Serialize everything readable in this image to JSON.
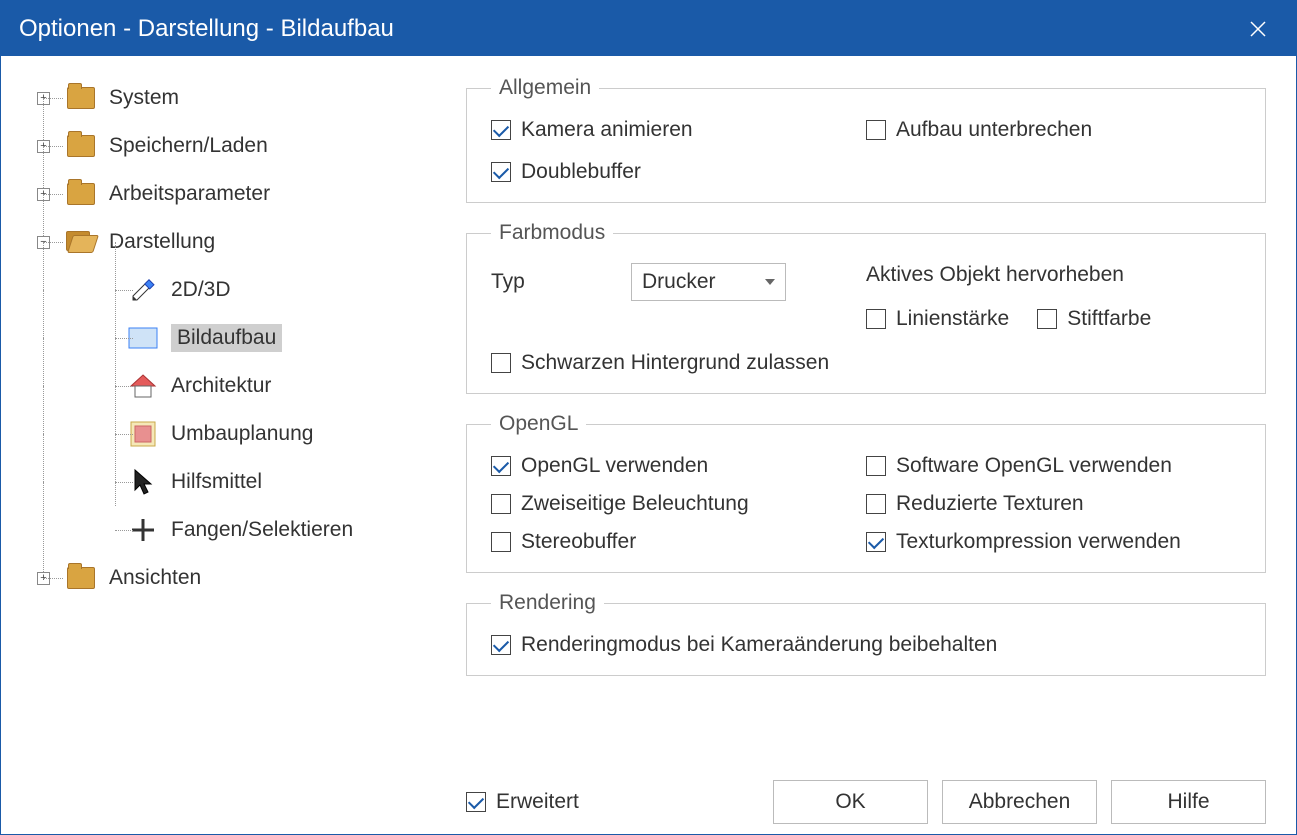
{
  "window": {
    "title": "Optionen - Darstellung - Bildaufbau"
  },
  "tree": {
    "system": "System",
    "speichern": "Speichern/Laden",
    "arbeit": "Arbeitsparameter",
    "darstellung": "Darstellung",
    "d_2d3d": "2D/3D",
    "d_bild": "Bildaufbau",
    "d_arch": "Architektur",
    "d_umbau": "Umbauplanung",
    "d_hilf": "Hilfsmittel",
    "d_fangen": "Fangen/Selektieren",
    "ansichten": "Ansichten"
  },
  "groups": {
    "allgemein": {
      "legend": "Allgemein",
      "kamera": "Kamera animieren",
      "doublebuffer": "Doublebuffer",
      "aufbau": "Aufbau unterbrechen"
    },
    "farbmodus": {
      "legend": "Farbmodus",
      "typ_label": "Typ",
      "typ_value": "Drucker",
      "aktives": "Aktives Objekt hervorheben",
      "linien": "Linienstärke",
      "stift": "Stiftfarbe",
      "schwarz": "Schwarzen Hintergrund zulassen"
    },
    "opengl": {
      "legend": "OpenGL",
      "use": "OpenGL verwenden",
      "zwei": "Zweiseitige Beleuchtung",
      "stereo": "Stereobuffer",
      "software": "Software OpenGL verwenden",
      "reduz": "Reduzierte Texturen",
      "texkomp": "Texturkompression verwenden"
    },
    "rendering": {
      "legend": "Rendering",
      "modus": "Renderingmodus bei Kameraänderung beibehalten"
    }
  },
  "footer": {
    "erweitert": "Erweitert",
    "ok": "OK",
    "abbrechen": "Abbrechen",
    "hilfe": "Hilfe"
  },
  "checked": {
    "kamera": true,
    "doublebuffer": true,
    "aufbau": false,
    "linien": false,
    "stift": false,
    "schwarz": false,
    "use": true,
    "zwei": false,
    "stereo": false,
    "software": false,
    "reduz": false,
    "texkomp": true,
    "modus": true,
    "erweitert": true
  }
}
